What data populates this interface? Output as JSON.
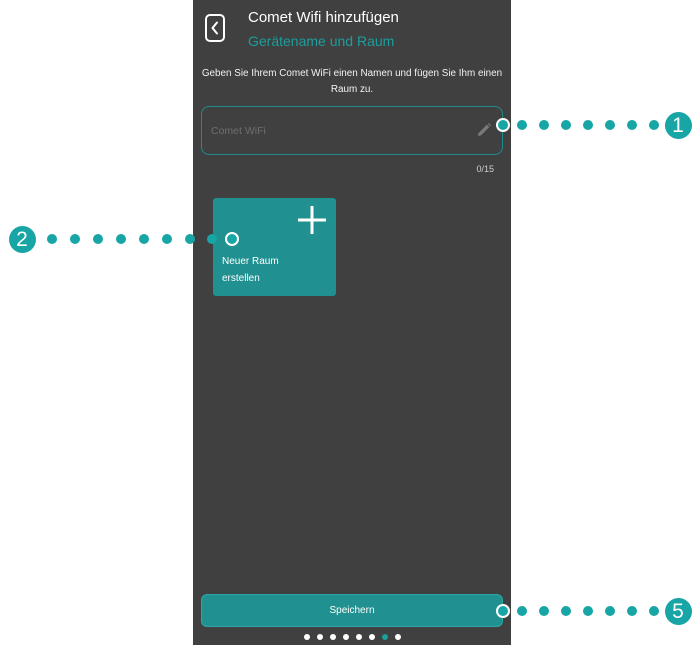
{
  "screen": {
    "back_icon": "chevron-left-icon",
    "title": "Comet Wifi hinzufügen",
    "subtitle": "Gerätename und Raum",
    "instruction": "Geben Sie Ihrem Comet WiFi einen Namen und fügen Sie Ihm einen Raum zu.",
    "name_input": {
      "placeholder": "Comet WiFi",
      "value": "",
      "edit_icon": "pencil-icon"
    },
    "char_counter": "0/15",
    "rooms": [
      {
        "label": "Neuer Raum erstellen",
        "icon": "plus-icon"
      }
    ],
    "save_label": "Speichern",
    "pagination": {
      "count": 8,
      "active": 7
    }
  },
  "annotations": [
    {
      "number": "1"
    },
    {
      "number": "2"
    },
    {
      "number": "5"
    }
  ],
  "colors": {
    "background": "#ffffff",
    "screen": "#404040",
    "accent": "#219090",
    "subtitle": "#1b9e9e",
    "annotation": "#17a5a5",
    "placeholder": "#6e6e6e"
  }
}
